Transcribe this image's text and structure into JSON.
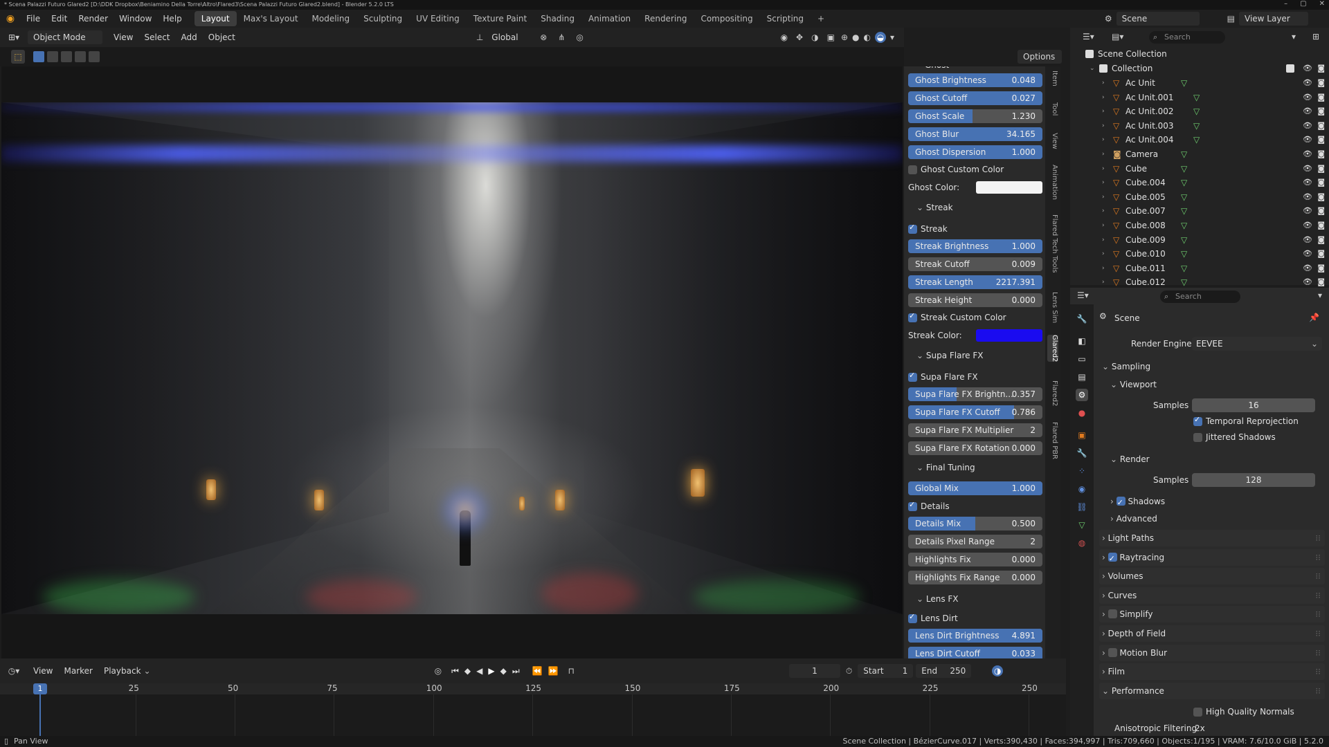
{
  "titlebar": {
    "title": "* Scena Palazzi Futuro Glared2 [D:\\DDK Dropbox\\Beniamino Della Torre\\Altro\\Flared3\\Scena Palazzi Futuro Glared2.blend] - Blender 5.2.0 LTS",
    "minimize": "–",
    "maximize": "▢",
    "close": "✕"
  },
  "topbar": {
    "menus": [
      "File",
      "Edit",
      "Render",
      "Window",
      "Help"
    ],
    "workspaces": [
      "Layout",
      "Max's Layout",
      "Modeling",
      "Sculpting",
      "UV Editing",
      "Texture Paint",
      "Shading",
      "Animation",
      "Rendering",
      "Compositing",
      "Scripting"
    ],
    "add_workspace": "+",
    "scene_label": "Scene",
    "view_layer_label": "View Layer"
  },
  "viewport_header": {
    "mode": "Object Mode",
    "menus": [
      "View",
      "Select",
      "Add",
      "Object"
    ],
    "transform_orientation": "Global",
    "options_label": "Options"
  },
  "npanel": {
    "ghost": {
      "header": "Ghost",
      "sliders": [
        {
          "label": "Ghost Brightness",
          "value": "0.048",
          "fill": 1.0
        },
        {
          "label": "Ghost Cutoff",
          "value": "0.027",
          "fill": 1.0
        },
        {
          "label": "Ghost Scale",
          "value": "1.230",
          "fill": 0.48
        },
        {
          "label": "Ghost Blur",
          "value": "34.165",
          "fill": 1.0
        },
        {
          "label": "Ghost Dispersion",
          "value": "1.000",
          "fill": 1.0
        }
      ],
      "custom_color_label": "Ghost Custom Color",
      "color_label": "Ghost Color:",
      "color": "#f4f4f4"
    },
    "streak": {
      "section": "Streak",
      "toggle_label": "Streak",
      "sliders": [
        {
          "label": "Streak Brightness",
          "value": "1.000",
          "fill": 1.0
        },
        {
          "label": "Streak Cutoff",
          "value": "0.009",
          "fill": 0.0
        },
        {
          "label": "Streak Length",
          "value": "2217.391",
          "fill": 1.0
        },
        {
          "label": "Streak Height",
          "value": "0.000",
          "fill": 0.0
        }
      ],
      "custom_color_label": "Streak Custom Color",
      "color_label": "Streak Color:",
      "color": "#1a0bf0"
    },
    "supa": {
      "section": "Supa Flare FX",
      "toggle_label": "Supa Flare FX",
      "sliders": [
        {
          "label": "Supa Flare FX Brightn...",
          "value": "0.357",
          "fill": 0.36
        },
        {
          "label": "Supa Flare FX Cutoff",
          "value": "0.786",
          "fill": 0.79
        },
        {
          "label": "Supa Flare FX Multiplier",
          "value": "2",
          "fill": 0.0
        },
        {
          "label": "Supa Flare FX Rotation",
          "value": "0.000",
          "fill": 0.0
        }
      ]
    },
    "final": {
      "section": "Final Tuning",
      "sliders": [
        {
          "label": "Global Mix",
          "value": "1.000",
          "fill": 1.0
        }
      ],
      "details_label": "Details",
      "details_sliders": [
        {
          "label": "Details Mix",
          "value": "0.500",
          "fill": 0.5
        },
        {
          "label": "Details Pixel Range",
          "value": "2",
          "fill": 0.0
        },
        {
          "label": "Highlights Fix",
          "value": "0.000",
          "fill": 0.0
        },
        {
          "label": "Highlights Fix Range",
          "value": "0.000",
          "fill": 0.0
        }
      ]
    },
    "lens": {
      "section": "Lens FX",
      "toggle_label": "Lens Dirt",
      "sliders": [
        {
          "label": "Lens Dirt Brightness",
          "value": "4.891",
          "fill": 1.0
        },
        {
          "label": "Lens Dirt Cutoff",
          "value": "0.033",
          "fill": 1.0
        }
      ]
    },
    "tabs": [
      "Item",
      "Tool",
      "View",
      "Animation",
      "Flared Tech Tools",
      "Lens Sim",
      "Glared2",
      "Flared2",
      "Flared PBR"
    ]
  },
  "outliner": {
    "search_placeholder": "Search",
    "root": "Scene Collection",
    "collection": "Collection",
    "items": [
      "Ac Unit",
      "Ac Unit.001",
      "Ac Unit.002",
      "Ac Unit.003",
      "Ac Unit.004",
      "Camera",
      "Cube",
      "Cube.004",
      "Cube.005",
      "Cube.007",
      "Cube.008",
      "Cube.009",
      "Cube.010",
      "Cube.011",
      "Cube.012"
    ]
  },
  "properties": {
    "search_placeholder": "Search",
    "context": "Scene",
    "render_engine_label": "Render Engine",
    "render_engine": "EEVEE",
    "sampling": "Sampling",
    "viewport": "Viewport",
    "samples_label": "Samples",
    "viewport_samples": "16",
    "temporal_reprojection": "Temporal Reprojection",
    "jittered_shadows": "Jittered Shadows",
    "render": "Render",
    "render_samples": "128",
    "shadows": "Shadows",
    "advanced": "Advanced",
    "panels": [
      "Light Paths",
      "Raytracing",
      "Volumes",
      "Curves",
      "Simplify",
      "Depth of Field",
      "Motion Blur",
      "Film",
      "Performance"
    ],
    "high_quality_normals": "High Quality Normals",
    "anisotropic_filtering": "Anisotropic Filtering",
    "anisotropic_value": "2x"
  },
  "timeline": {
    "menus": [
      "View",
      "Marker",
      "Playback"
    ],
    "current_frame": "1",
    "start_label": "Start",
    "start": "1",
    "end_label": "End",
    "end": "250",
    "ticks": [
      "1",
      "25",
      "50",
      "75",
      "100",
      "125",
      "150",
      "175",
      "200",
      "225",
      "250"
    ]
  },
  "statusbar": {
    "left": "Pan View",
    "right": "Scene Collection | BézierCurve.017 | Verts:390,430 | Faces:394,997 | Tris:709,660 | Objects:1/195 | VRAM: 7.6/10.0 GiB | 5.2.0"
  },
  "colors": {
    "accent": "#4772b3",
    "slider_bg": "#545454",
    "panel_bg": "#2a2a2a",
    "mesh_icon": "#e07a1f",
    "data_icon": "#6fcf6f"
  }
}
